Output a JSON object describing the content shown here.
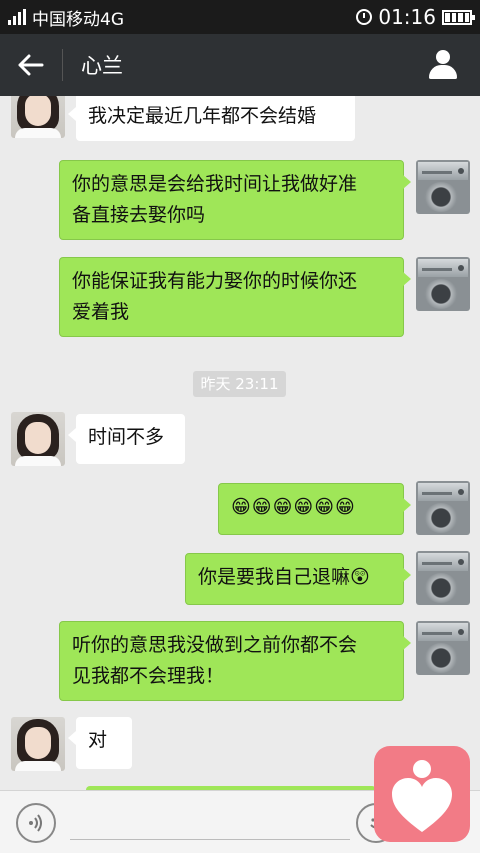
{
  "status_bar": {
    "carrier": "中国移动4G",
    "time": "01:16"
  },
  "header": {
    "title": "心兰"
  },
  "messages": [
    {
      "side": "in",
      "text": "我决定最近几年都不会结婚"
    },
    {
      "side": "out",
      "text": "你的意思是会给我时间让我做好准\n备直接去娶你吗"
    },
    {
      "side": "out",
      "text": "你能保证我有能力娶你的时候你还\n爱着我"
    },
    {
      "side": "in",
      "text": "时间不多"
    },
    {
      "side": "out",
      "text": "😁😁😁😁😁😁"
    },
    {
      "side": "out",
      "text": "你是要我自己退嘛😲"
    },
    {
      "side": "out",
      "text": "听你的意思我没做到之前你都不会\n见我都不会理我！"
    },
    {
      "side": "in",
      "text": "对"
    }
  ],
  "timestamp": "昨天 23:11",
  "icons": {
    "back": "arrow-left-icon",
    "profile": "person-icon",
    "voice": "voice-icon",
    "emoji": "emoji-icon"
  },
  "colors": {
    "out_bubble": "#9fe658",
    "in_bubble": "#ffffff",
    "title_bar": "#2e3134"
  }
}
